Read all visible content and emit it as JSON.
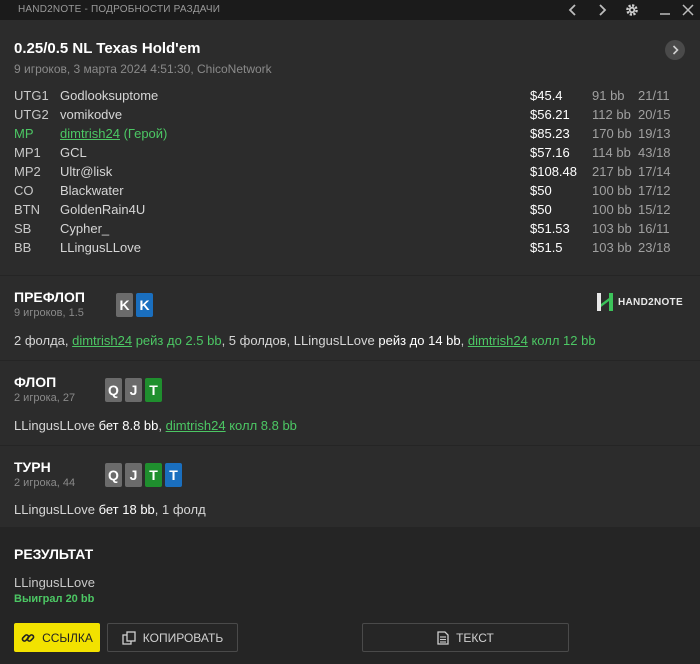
{
  "window": {
    "title": "HAND2NOTE - ПОДРОБНОСТИ РАЗДАЧИ",
    "prev_icon": "chevron-left-icon",
    "next_icon": "chevron-right-icon",
    "settings_icon": "gear-icon",
    "minimize_icon": "minimize-icon",
    "close_icon": "close-icon"
  },
  "hand": {
    "title": "0.25/0.5 NL Texas Hold'em",
    "subtitle": "9 игроков, 3 марта 2024 4:51:30, ChicoNetwork"
  },
  "players": [
    {
      "pos": "UTG1",
      "name": "Godlooksuptome",
      "stack": "$45.4",
      "bb": "91 bb",
      "count": "21/11",
      "hero": false
    },
    {
      "pos": "UTG2",
      "name": "vomikodve",
      "stack": "$56.21",
      "bb": "112 bb",
      "count": "20/15",
      "hero": false
    },
    {
      "pos": "MP",
      "name": "dimtrish24",
      "hero_tag": "(Герой)",
      "stack": "$85.23",
      "bb": "170 bb",
      "count": "19/13",
      "hero": true
    },
    {
      "pos": "MP1",
      "name": "GCL",
      "stack": "$57.16",
      "bb": "114 bb",
      "count": "43/18",
      "hero": false
    },
    {
      "pos": "MP2",
      "name": "Ultr@lisk",
      "stack": "$108.48",
      "bb": "217 bb",
      "count": "17/14",
      "hero": false
    },
    {
      "pos": "CO",
      "name": "Blackwater",
      "stack": "$50",
      "bb": "100 bb",
      "count": "17/12",
      "hero": false
    },
    {
      "pos": "BTN",
      "name": "GoldenRain4U",
      "stack": "$50",
      "bb": "100 bb",
      "count": "15/12",
      "hero": false
    },
    {
      "pos": "SB",
      "name": "Cypher_",
      "stack": "$51.53",
      "bb": "103 bb",
      "count": "16/11",
      "hero": false
    },
    {
      "pos": "BB",
      "name": "LLingusLLove",
      "stack": "$51.5",
      "bb": "103 bb",
      "count": "23/18",
      "hero": false
    }
  ],
  "preflop": {
    "title": "ПРЕФЛОП",
    "subtitle": "9 игроков, 1.5",
    "cards": [
      {
        "rank": "K",
        "color": "grey"
      },
      {
        "rank": "K",
        "color": "blue"
      }
    ],
    "action": {
      "a1": "2 фолда, ",
      "hero": "dimtrish24",
      "a2": " рейз до 2.5 bb",
      "a3": ", 5 фолдов, LLingusLLove ",
      "a4": "рейз до 14 bb",
      "a5": ", ",
      "hero2": "dimtrish24",
      "a6": " колл 12 bb"
    }
  },
  "flop": {
    "title": "ФЛОП",
    "subtitle": "2 игрока, 27",
    "cards": [
      {
        "rank": "Q",
        "color": "grey"
      },
      {
        "rank": "J",
        "color": "grey"
      },
      {
        "rank": "T",
        "color": "green"
      }
    ],
    "action": {
      "a1": "LLingusLLove ",
      "a2": "бет 8.8 bb",
      "a3": ", ",
      "hero": "dimtrish24",
      "a4": " колл 8.8 bb"
    }
  },
  "turn": {
    "title": "ТУРН",
    "subtitle": "2 игрока, 44",
    "cards": [
      {
        "rank": "Q",
        "color": "grey"
      },
      {
        "rank": "J",
        "color": "grey"
      },
      {
        "rank": "T",
        "color": "green"
      },
      {
        "rank": "T",
        "color": "blue"
      }
    ],
    "action": {
      "a1": "LLingusLLove ",
      "a2": "бет 18 bb",
      "a3": ", 1 фолд"
    }
  },
  "result": {
    "title": "РЕЗУЛЬТАТ",
    "winner": "LLingusLLove",
    "won": "Выиграл 20 bb"
  },
  "logo_text": "HAND2NOTE",
  "buttons": {
    "link": "ССЫЛКА",
    "copy": "КОПИРОВАТЬ",
    "text": "ТЕКСТ"
  },
  "colors": {
    "hero_green": "#4cc764",
    "accent_yellow": "#f2e200",
    "card_blue": "#1a6fbf",
    "card_green": "#1f8f2e",
    "card_grey": "#6b6b6b"
  }
}
